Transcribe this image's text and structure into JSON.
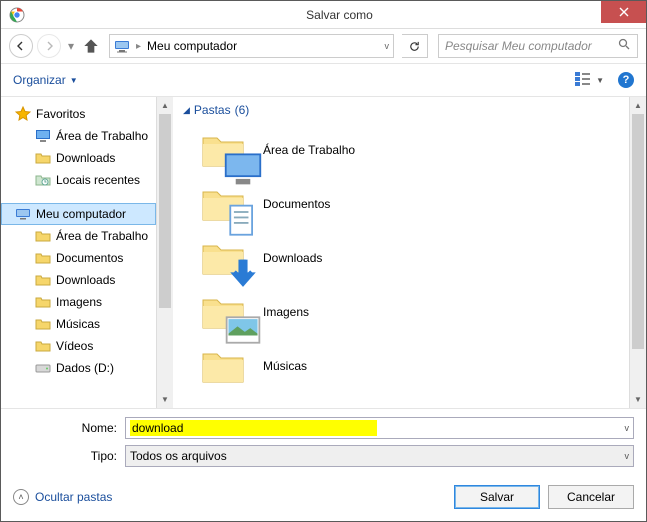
{
  "window": {
    "title": "Salvar como"
  },
  "nav": {
    "location": "Meu computador",
    "search_placeholder": "Pesquisar Meu computador"
  },
  "toolbar": {
    "organize": "Organizar"
  },
  "tree": {
    "favorites": {
      "label": "Favoritos",
      "items": [
        {
          "label": "Área de Trabalho",
          "icon": "desktop"
        },
        {
          "label": "Downloads",
          "icon": "folder"
        },
        {
          "label": "Locais recentes",
          "icon": "recent"
        }
      ]
    },
    "computer": {
      "label": "Meu computador",
      "items": [
        {
          "label": "Área de Trabalho",
          "icon": "folder"
        },
        {
          "label": "Documentos",
          "icon": "folder"
        },
        {
          "label": "Downloads",
          "icon": "folder"
        },
        {
          "label": "Imagens",
          "icon": "folder"
        },
        {
          "label": "Músicas",
          "icon": "folder"
        },
        {
          "label": "Vídeos",
          "icon": "folder"
        },
        {
          "label": "Dados (D:)",
          "icon": "drive"
        }
      ]
    }
  },
  "content": {
    "group_label": "Pastas",
    "group_count": "(6)",
    "folders": [
      {
        "label": "Área de Trabalho"
      },
      {
        "label": "Documentos"
      },
      {
        "label": "Downloads"
      },
      {
        "label": "Imagens"
      },
      {
        "label": "Músicas"
      }
    ]
  },
  "fields": {
    "name_label": "Nome:",
    "name_value": "download",
    "type_label": "Tipo:",
    "type_value": "Todos os arquivos"
  },
  "footer": {
    "hide_folders": "Ocultar pastas",
    "save": "Salvar",
    "cancel": "Cancelar"
  }
}
